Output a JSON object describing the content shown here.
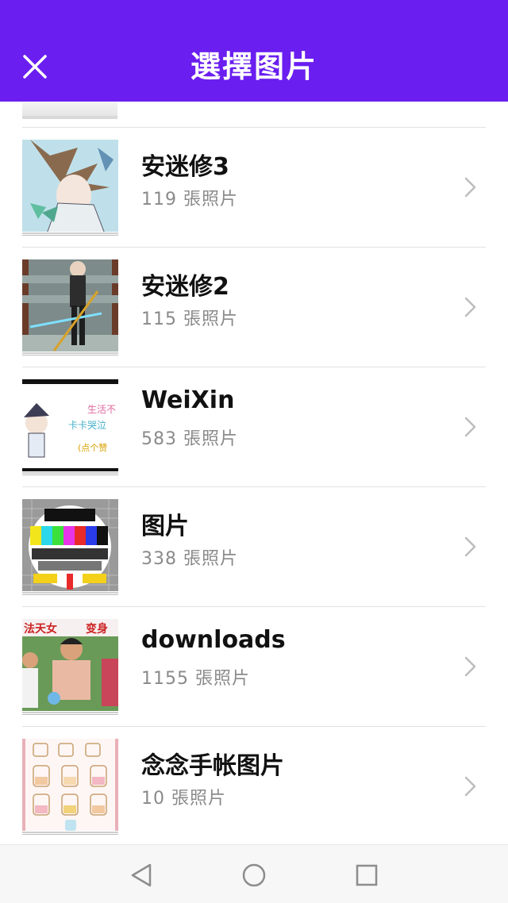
{
  "header": {
    "title": "選擇图片",
    "close_icon": "close-icon",
    "background": "#6a1ef0"
  },
  "albums": [
    {
      "name": "安迷修3",
      "count": "119 張照片",
      "thumb": "anime-boy-teal"
    },
    {
      "name": "安迷修2",
      "count": "115 張照片",
      "thumb": "anime-swordsman"
    },
    {
      "name": "WeiXin",
      "count": "583 張照片",
      "thumb": "comic-strip"
    },
    {
      "name": "图片",
      "count": "338 張照片",
      "thumb": "tv-test-pattern"
    },
    {
      "name": "downloads",
      "count": "1155 張照片",
      "thumb": "photo-people"
    },
    {
      "name": "念念手帐图片",
      "count": "10 張照片",
      "thumb": "sticker-sheet"
    }
  ],
  "nav": {
    "back": "back-triangle-icon",
    "home": "home-circle-icon",
    "recents": "recents-square-icon"
  }
}
